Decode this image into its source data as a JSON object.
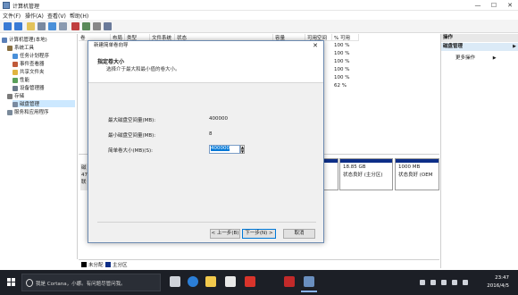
{
  "window": {
    "title": "计算机管理",
    "minimize": "—",
    "maximize": "☐",
    "close": "✕"
  },
  "menu": [
    "文件(F)",
    "操作(A)",
    "查看(V)",
    "帮助(H)"
  ],
  "tree": [
    {
      "label": "计算机管理(本地)",
      "indent": 0,
      "icon_color": "#5a7fb8"
    },
    {
      "label": "系统工具",
      "indent": 1,
      "icon_color": "#8a7040"
    },
    {
      "label": "任务计划程序",
      "indent": 2,
      "icon_color": "#4a90d9"
    },
    {
      "label": "事件查看器",
      "indent": 2,
      "icon_color": "#c05a3a"
    },
    {
      "label": "共享文件夹",
      "indent": 2,
      "icon_color": "#e0b440"
    },
    {
      "label": "性能",
      "indent": 2,
      "icon_color": "#5aa05a"
    },
    {
      "label": "设备管理器",
      "indent": 2,
      "icon_color": "#6a7a8a"
    },
    {
      "label": "存储",
      "indent": 1,
      "icon_color": "#7a7a7a"
    },
    {
      "label": "磁盘管理",
      "indent": 2,
      "icon_color": "#7a8aa0"
    },
    {
      "label": "服务和应用程序",
      "indent": 1,
      "icon_color": "#7a8a9a"
    }
  ],
  "columns": [
    "卷",
    "布局",
    "类型",
    "文件系统",
    "状态",
    "容量",
    "可用空间",
    "% 可用"
  ],
  "rows_pct": [
    "100 %",
    "100 %",
    "100 %",
    "100 %",
    "100 %",
    "62 %"
  ],
  "rows_pct_marks": [
    "B",
    "B",
    "B",
    "B",
    "B",
    "B"
  ],
  "diskmap": {
    "disk_label_lines": [
      "磁",
      "47",
      "联"
    ],
    "partitions": [
      {
        "size": "18.85 GB",
        "status": "状态良好 (主分区)"
      },
      {
        "size": "1000 MB",
        "status": "状态良好 (OEM"
      }
    ]
  },
  "legend": [
    {
      "label": "未分配",
      "color": "#000000"
    },
    {
      "label": "主分区",
      "color": "#0d2e87"
    }
  ],
  "actions": {
    "header": "操作",
    "section": "磁盘管理",
    "more": "更多操作",
    "arrow": "▶"
  },
  "wizard": {
    "title": "新建简单卷向导",
    "close": "✕",
    "heading": "指定卷大小",
    "description": "选择介于最大和最小值的卷大小。",
    "max_label": "最大磁盘空间量(MB):",
    "max_value": "400000",
    "min_label": "最小磁盘空间量(MB):",
    "min_value": "8",
    "size_label": "简单卷大小(MB)(S):",
    "size_value": "400000",
    "spin_up": "▲",
    "spin_down": "▼",
    "back_button": "< 上一步(B)",
    "next_button": "下一步(N) >",
    "cancel_button": "取消"
  },
  "taskbar": {
    "search_placeholder": "我是 Cortana，小娜。有问题尽管问我。",
    "time": "23:47",
    "date": "2016/4/5",
    "apps": [
      {
        "name": "task-view-icon",
        "color": "#cfd3da"
      },
      {
        "name": "edge-icon",
        "color": "#2b7fd8"
      },
      {
        "name": "file-explorer-icon",
        "color": "#f2c94c"
      },
      {
        "name": "store-icon",
        "color": "#e8e8e8"
      },
      {
        "name": "red-app-icon",
        "color": "#d9342b"
      },
      {
        "name": "shield-app-icon",
        "color": "#c22a2a"
      },
      {
        "name": "computer-management-icon",
        "color": "#6a8fbf"
      }
    ]
  }
}
